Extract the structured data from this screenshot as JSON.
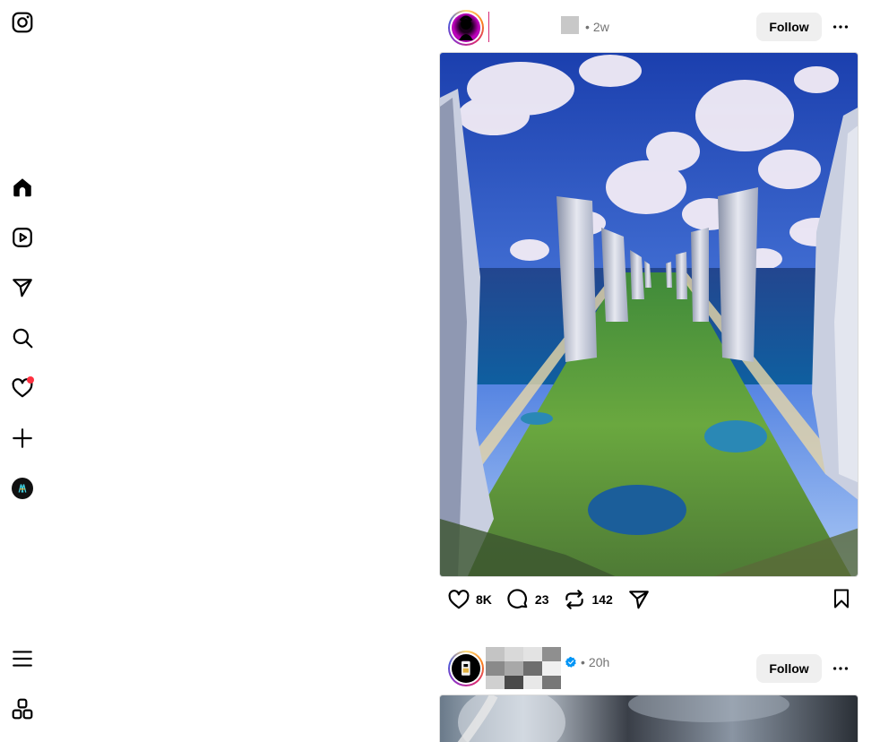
{
  "app": {
    "name": "Instagram"
  },
  "sidebar": {
    "items": [
      {
        "name": "home",
        "label": "Home"
      },
      {
        "name": "reels",
        "label": "Reels"
      },
      {
        "name": "messages",
        "label": "Messages"
      },
      {
        "name": "search",
        "label": "Search"
      },
      {
        "name": "notifications",
        "label": "Notifications",
        "has_badge": true
      },
      {
        "name": "create",
        "label": "Create"
      },
      {
        "name": "profile",
        "label": "Profile"
      }
    ],
    "bottom": [
      {
        "name": "more",
        "label": "More"
      },
      {
        "name": "also-from-meta",
        "label": "Also from Meta"
      }
    ]
  },
  "posts": [
    {
      "time": "2w",
      "follow_label": "Follow",
      "likes": "8K",
      "comments": "23",
      "reposts": "142",
      "image_alt": "Surreal landscape of towering white stone walls lining a green valley toward the sea under puffy clouds"
    },
    {
      "time": "20h",
      "verified": true,
      "follow_label": "Follow"
    }
  ],
  "colors": {
    "notification_dot": "#ff3040",
    "verified_blue": "#0095f6",
    "follow_bg": "#efefef",
    "meta_gray": "#737373"
  }
}
